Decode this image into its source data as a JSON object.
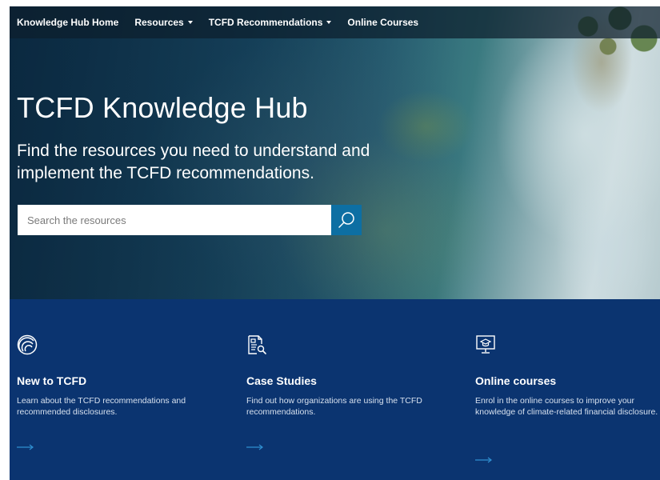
{
  "nav": {
    "items": [
      {
        "label": "Knowledge Hub Home",
        "dropdown": false
      },
      {
        "label": "Resources",
        "dropdown": true
      },
      {
        "label": "TCFD Recommendations",
        "dropdown": true
      },
      {
        "label": "Online Courses",
        "dropdown": false
      }
    ]
  },
  "hero": {
    "title": "TCFD Knowledge Hub",
    "subtitle": "Find the resources you need to understand and implement the TCFD recommendations."
  },
  "search": {
    "placeholder": "Search the resources",
    "value": "",
    "icon": "search-icon"
  },
  "features": [
    {
      "icon": "signal-waves-icon",
      "title": "New to TCFD",
      "description": "Learn about the TCFD recommendations and recommended disclosures.",
      "arrow": "arrow-right-icon"
    },
    {
      "icon": "document-search-icon",
      "title": "Case Studies",
      "description": "Find out how organizations are using the TCFD recommendations.",
      "arrow": "arrow-right-icon"
    },
    {
      "icon": "online-course-monitor-icon",
      "title": "Online courses",
      "description": "Enrol in the online courses to improve your knowledge of climate-related financial disclosure.",
      "arrow": "arrow-right-icon"
    }
  ],
  "colors": {
    "nav_bg": "#0c1e2d",
    "features_bg": "#0b3470",
    "search_button": "#0d6fa3",
    "link_arrow": "#2f8fd0"
  }
}
